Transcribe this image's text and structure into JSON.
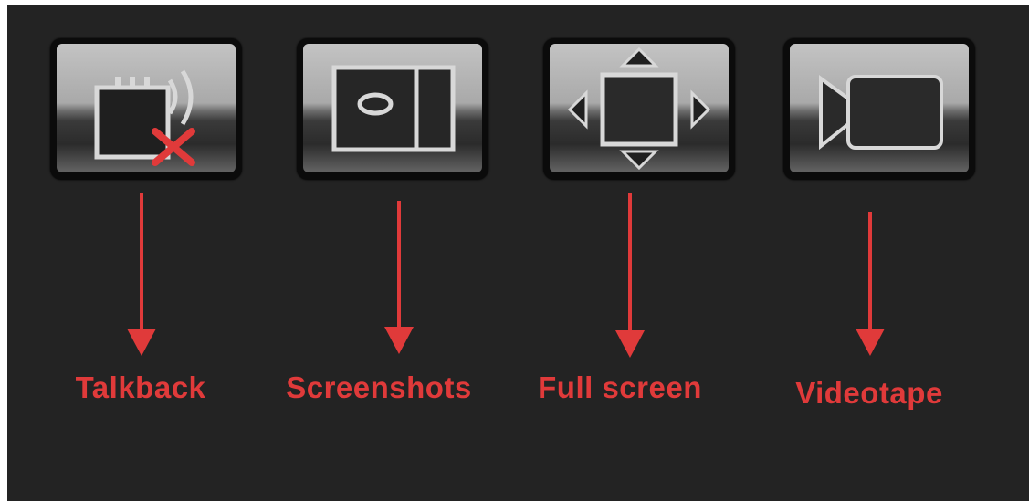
{
  "toolbar": {
    "buttons": [
      {
        "id": "talkback",
        "label": "Talkback",
        "icon": "talkback-muted-icon"
      },
      {
        "id": "screenshots",
        "label": "Screenshots",
        "icon": "camera-snapshot-icon"
      },
      {
        "id": "fullscreen",
        "label": "Full screen",
        "icon": "fullscreen-arrows-icon"
      },
      {
        "id": "videotape",
        "label": "Videotape",
        "icon": "video-camera-icon"
      }
    ]
  },
  "colors": {
    "background": "#232323",
    "annotation": "#e03a3a",
    "icon_outline": "#d8d8d8"
  }
}
